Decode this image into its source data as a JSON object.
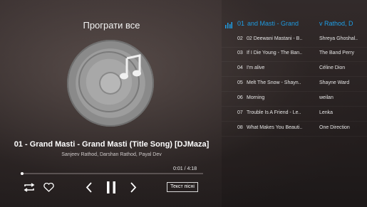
{
  "player": {
    "play_all_label": "Програти все",
    "title": "01 - Grand Masti - Grand Masti (Title Song) [DJMaza]",
    "artist": "Sanjeev Rathod, Darshan Rathod, Payal Dev",
    "time": "0:01 / 4:18",
    "progress_fraction": 0.004,
    "lyrics_button_label": "Текст пісні",
    "icons": {
      "repeat": "repeat-icon",
      "favorite": "heart-icon",
      "previous": "previous-icon",
      "pause": "pause-icon",
      "next": "next-icon",
      "album_art": "music-note-disc-icon"
    }
  },
  "playlist": {
    "current": {
      "number": "01",
      "title": "and Masti - Grand",
      "artist": "v Rathod, D",
      "indicator_icon": "equalizer-bars-icon",
      "accent_color": "#1e9fe8"
    },
    "items": [
      {
        "number": "02",
        "title": "02 Deewani Mastani - B..",
        "artist": "Shreya Ghoshal.."
      },
      {
        "number": "03",
        "title": "If I Die Young - The Ban..",
        "artist": "The Band Perry"
      },
      {
        "number": "04",
        "title": "I'm alive",
        "artist": "Céline Dion"
      },
      {
        "number": "05",
        "title": "Melt The Snow - Shayn..",
        "artist": "Shayne Ward"
      },
      {
        "number": "06",
        "title": "Morning",
        "artist": "weilan"
      },
      {
        "number": "07",
        "title": "Trouble Is A Friend - Le..",
        "artist": "Lenka"
      },
      {
        "number": "08",
        "title": "What Makes You Beauti..",
        "artist": "One Direction"
      }
    ]
  }
}
